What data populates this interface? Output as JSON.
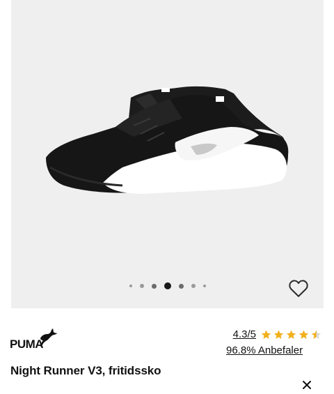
{
  "product": {
    "brand": "PUMA",
    "title": "Night Runner V3, fritidssko"
  },
  "gallery": {
    "image_count": 7,
    "active_index": 3
  },
  "rating": {
    "value_text": "4.3/5",
    "stars": 4.3,
    "star_color": "#f2b01e",
    "recommend_text": "96.8% Anbefaler"
  },
  "icons": {
    "favorite": "heart-outline-icon",
    "close": "close-icon"
  }
}
